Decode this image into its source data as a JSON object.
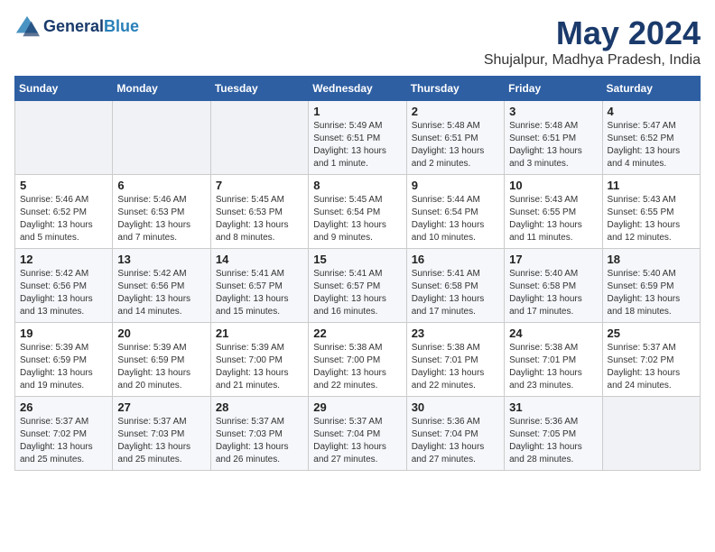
{
  "header": {
    "logo_line1": "General",
    "logo_line2": "Blue",
    "month_year": "May 2024",
    "location": "Shujalpur, Madhya Pradesh, India"
  },
  "weekdays": [
    "Sunday",
    "Monday",
    "Tuesday",
    "Wednesday",
    "Thursday",
    "Friday",
    "Saturday"
  ],
  "weeks": [
    [
      {
        "day": "",
        "text": ""
      },
      {
        "day": "",
        "text": ""
      },
      {
        "day": "",
        "text": ""
      },
      {
        "day": "1",
        "text": "Sunrise: 5:49 AM\nSunset: 6:51 PM\nDaylight: 13 hours\nand 1 minute."
      },
      {
        "day": "2",
        "text": "Sunrise: 5:48 AM\nSunset: 6:51 PM\nDaylight: 13 hours\nand 2 minutes."
      },
      {
        "day": "3",
        "text": "Sunrise: 5:48 AM\nSunset: 6:51 PM\nDaylight: 13 hours\nand 3 minutes."
      },
      {
        "day": "4",
        "text": "Sunrise: 5:47 AM\nSunset: 6:52 PM\nDaylight: 13 hours\nand 4 minutes."
      }
    ],
    [
      {
        "day": "5",
        "text": "Sunrise: 5:46 AM\nSunset: 6:52 PM\nDaylight: 13 hours\nand 5 minutes."
      },
      {
        "day": "6",
        "text": "Sunrise: 5:46 AM\nSunset: 6:53 PM\nDaylight: 13 hours\nand 7 minutes."
      },
      {
        "day": "7",
        "text": "Sunrise: 5:45 AM\nSunset: 6:53 PM\nDaylight: 13 hours\nand 8 minutes."
      },
      {
        "day": "8",
        "text": "Sunrise: 5:45 AM\nSunset: 6:54 PM\nDaylight: 13 hours\nand 9 minutes."
      },
      {
        "day": "9",
        "text": "Sunrise: 5:44 AM\nSunset: 6:54 PM\nDaylight: 13 hours\nand 10 minutes."
      },
      {
        "day": "10",
        "text": "Sunrise: 5:43 AM\nSunset: 6:55 PM\nDaylight: 13 hours\nand 11 minutes."
      },
      {
        "day": "11",
        "text": "Sunrise: 5:43 AM\nSunset: 6:55 PM\nDaylight: 13 hours\nand 12 minutes."
      }
    ],
    [
      {
        "day": "12",
        "text": "Sunrise: 5:42 AM\nSunset: 6:56 PM\nDaylight: 13 hours\nand 13 minutes."
      },
      {
        "day": "13",
        "text": "Sunrise: 5:42 AM\nSunset: 6:56 PM\nDaylight: 13 hours\nand 14 minutes."
      },
      {
        "day": "14",
        "text": "Sunrise: 5:41 AM\nSunset: 6:57 PM\nDaylight: 13 hours\nand 15 minutes."
      },
      {
        "day": "15",
        "text": "Sunrise: 5:41 AM\nSunset: 6:57 PM\nDaylight: 13 hours\nand 16 minutes."
      },
      {
        "day": "16",
        "text": "Sunrise: 5:41 AM\nSunset: 6:58 PM\nDaylight: 13 hours\nand 17 minutes."
      },
      {
        "day": "17",
        "text": "Sunrise: 5:40 AM\nSunset: 6:58 PM\nDaylight: 13 hours\nand 17 minutes."
      },
      {
        "day": "18",
        "text": "Sunrise: 5:40 AM\nSunset: 6:59 PM\nDaylight: 13 hours\nand 18 minutes."
      }
    ],
    [
      {
        "day": "19",
        "text": "Sunrise: 5:39 AM\nSunset: 6:59 PM\nDaylight: 13 hours\nand 19 minutes."
      },
      {
        "day": "20",
        "text": "Sunrise: 5:39 AM\nSunset: 6:59 PM\nDaylight: 13 hours\nand 20 minutes."
      },
      {
        "day": "21",
        "text": "Sunrise: 5:39 AM\nSunset: 7:00 PM\nDaylight: 13 hours\nand 21 minutes."
      },
      {
        "day": "22",
        "text": "Sunrise: 5:38 AM\nSunset: 7:00 PM\nDaylight: 13 hours\nand 22 minutes."
      },
      {
        "day": "23",
        "text": "Sunrise: 5:38 AM\nSunset: 7:01 PM\nDaylight: 13 hours\nand 22 minutes."
      },
      {
        "day": "24",
        "text": "Sunrise: 5:38 AM\nSunset: 7:01 PM\nDaylight: 13 hours\nand 23 minutes."
      },
      {
        "day": "25",
        "text": "Sunrise: 5:37 AM\nSunset: 7:02 PM\nDaylight: 13 hours\nand 24 minutes."
      }
    ],
    [
      {
        "day": "26",
        "text": "Sunrise: 5:37 AM\nSunset: 7:02 PM\nDaylight: 13 hours\nand 25 minutes."
      },
      {
        "day": "27",
        "text": "Sunrise: 5:37 AM\nSunset: 7:03 PM\nDaylight: 13 hours\nand 25 minutes."
      },
      {
        "day": "28",
        "text": "Sunrise: 5:37 AM\nSunset: 7:03 PM\nDaylight: 13 hours\nand 26 minutes."
      },
      {
        "day": "29",
        "text": "Sunrise: 5:37 AM\nSunset: 7:04 PM\nDaylight: 13 hours\nand 27 minutes."
      },
      {
        "day": "30",
        "text": "Sunrise: 5:36 AM\nSunset: 7:04 PM\nDaylight: 13 hours\nand 27 minutes."
      },
      {
        "day": "31",
        "text": "Sunrise: 5:36 AM\nSunset: 7:05 PM\nDaylight: 13 hours\nand 28 minutes."
      },
      {
        "day": "",
        "text": ""
      }
    ]
  ]
}
